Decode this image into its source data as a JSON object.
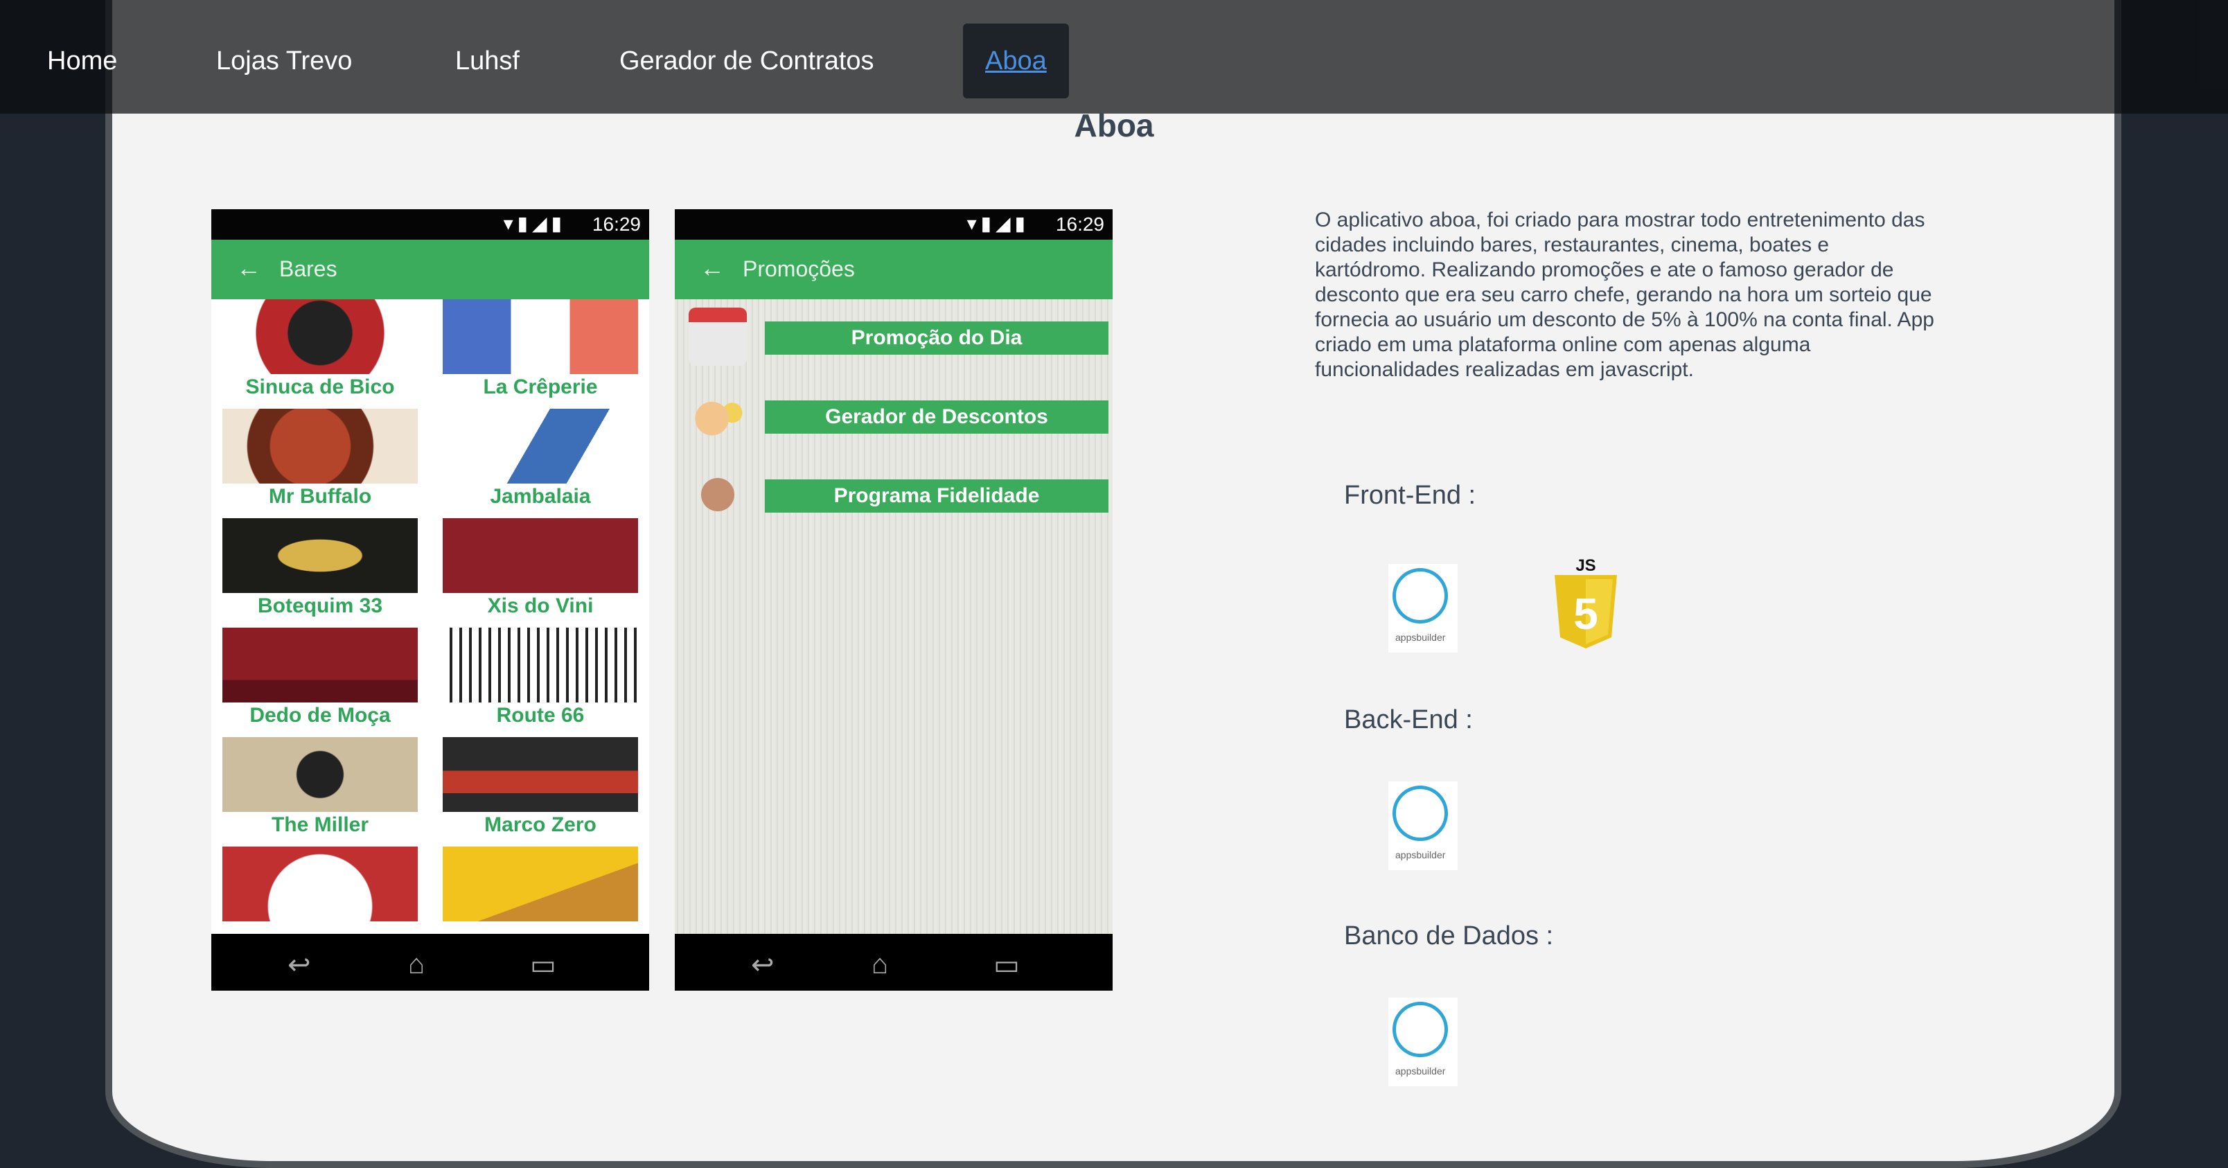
{
  "nav": {
    "items": [
      "Home",
      "Lojas Trevo",
      "Luhsf",
      "Gerador de Contratos",
      "Aboa"
    ],
    "active_index": 4
  },
  "page": {
    "title": "Aboa",
    "description": "O aplicativo aboa, foi criado para mostrar todo entretenimento das cidades incluindo bares, restaurantes, cinema, boates e kartódromo. Realizando promoções e ate o famoso gerador de desconto que era seu carro chefe, gerando na hora um sorteio que fornecia ao usuário um desconto de 5% à 100% na conta final. App criado em uma plataforma online com apenas alguma funcionalidades realizadas em javascript."
  },
  "phone1": {
    "time": "16:29",
    "appbar_title": "Bares",
    "tiles": [
      "Sinuca de Bico",
      "La Crêperie",
      "Mr Buffalo",
      "Jambalaia",
      "Botequim 33",
      "Xis do Vini",
      "Dedo de Moça",
      "Route 66",
      "The Miller",
      "Marco Zero"
    ]
  },
  "phone2": {
    "time": "16:29",
    "appbar_title": "Promoções",
    "buttons": [
      "Promoção do Dia",
      "Gerador de Descontos",
      "Programa Fidelidade"
    ]
  },
  "stack": {
    "front_end": "Front-End :",
    "back_end": "Back-End :",
    "database": "Banco de Dados :",
    "appsbuilder_label": "appsbuilder",
    "js_label": "JS",
    "js_number": "5"
  },
  "colors": {
    "accent_green": "#3bab5c",
    "nav_active_link": "#4a8fe0",
    "text": "#3b4654"
  }
}
